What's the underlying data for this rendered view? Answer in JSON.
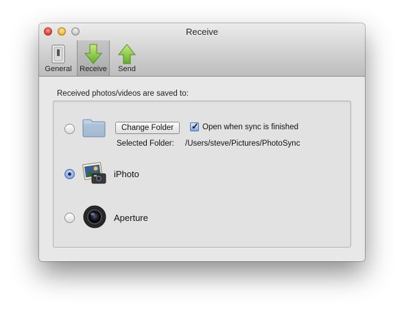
{
  "window": {
    "title": "Receive"
  },
  "toolbar": {
    "items": [
      {
        "label": "General",
        "icon": "switch-icon",
        "selected": false
      },
      {
        "label": "Receive",
        "icon": "down-arrow-icon",
        "selected": true
      },
      {
        "label": "Send",
        "icon": "up-arrow-icon",
        "selected": false
      }
    ]
  },
  "content": {
    "intro": "Received photos/videos are saved to:",
    "folder_option": {
      "selected": false,
      "change_button": "Change Folder",
      "open_when_done_label": "Open when sync is finished",
      "open_when_done_checked": true,
      "selected_folder_label": "Selected Folder:",
      "selected_folder_path": "/Users/steve/Pictures/PhotoSync"
    },
    "iphoto_option": {
      "label": "iPhoto",
      "selected": true
    },
    "aperture_option": {
      "label": "Aperture",
      "selected": false
    }
  },
  "colors": {
    "arrow_green": "#7cc440",
    "selection_blue": "#5c86c8"
  }
}
